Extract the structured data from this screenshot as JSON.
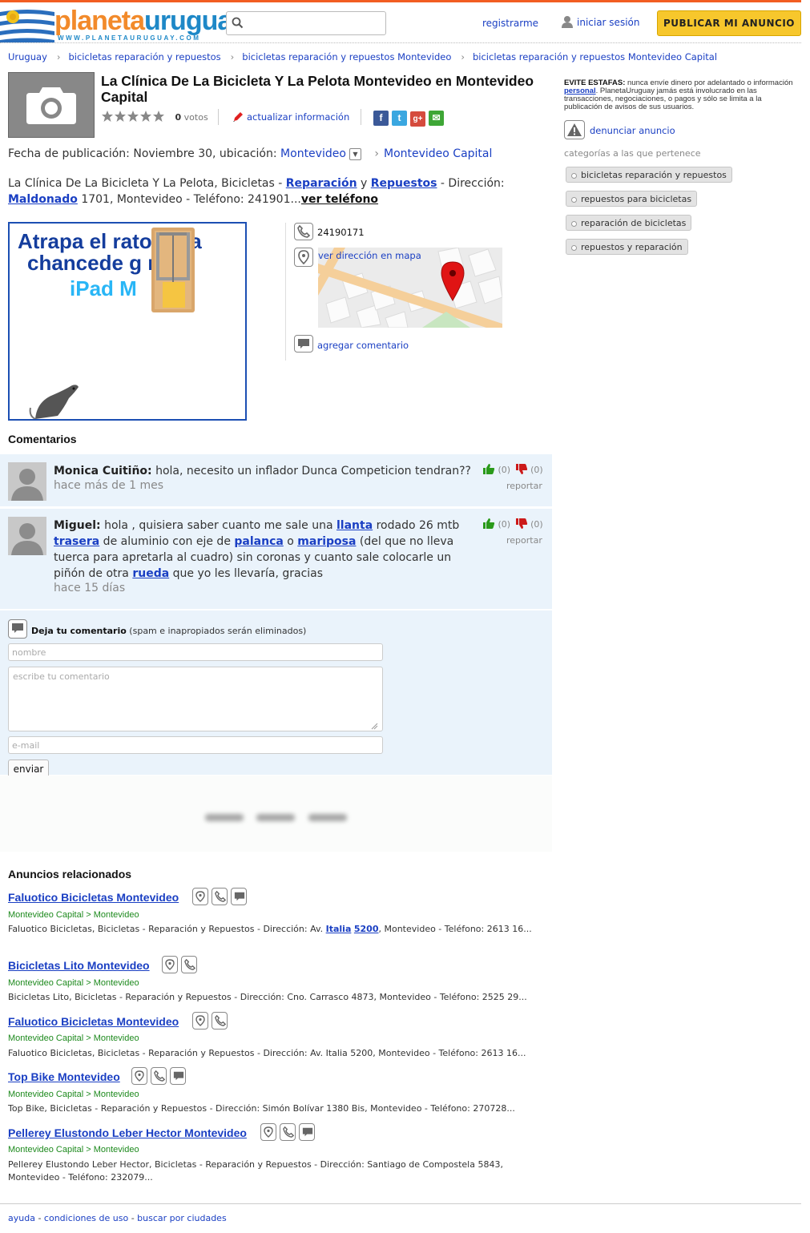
{
  "header": {
    "logo_part1": "planeta",
    "logo_part2": "uruguay",
    "logo_sub": "WWW.PLANETAURUGUAY.COM",
    "search_placeholder": "",
    "register": "registrarme",
    "login": "iniciar sesión",
    "publish": "PUBLICAR MI ANUNCIO"
  },
  "breadcrumb": [
    "Uruguay",
    "bicicletas reparación y repuestos",
    "bicicletas reparación y repuestos Montevideo",
    "bicicletas reparación y repuestos Montevideo Capital"
  ],
  "listing": {
    "title": "La Clínica De La Bicicleta Y La Pelota Montevideo en Montevideo Capital",
    "votes_count": "0",
    "votes_label": "votos",
    "update_link": "actualizar información",
    "pub_prefix": "Fecha de publicación: Noviembre 30, ubicación:",
    "location_city": "Montevideo",
    "location_area": "Montevideo Capital",
    "desc_1": "La Clínica De La Bicicleta Y La Pelota, Bicicletas - ",
    "desc_link1": "Reparación",
    "desc_2": " y ",
    "desc_link2": "Repuestos",
    "desc_3": " - Dirección: ",
    "desc_link3": "Maldonado",
    "desc_4": " 1701, Montevideo - Teléfono: 241901...",
    "desc_view_phone": "ver teléfono",
    "phone": "24190171",
    "map_link": "ver dirección en mapa",
    "add_comment": "agregar comentario"
  },
  "ad": {
    "line1": "Atrapa el rato   or la",
    "line2": "chancede g      r un",
    "line3": "iPad M"
  },
  "comments_title": "Comentarios",
  "comments": [
    {
      "author": "Monica Cuitiño:",
      "text": " hola, necesito un inflador Dunca Competicion tendran??",
      "time": "hace más de 1 mes",
      "likes": "(0)",
      "dislikes": "(0)",
      "report": "reportar"
    },
    {
      "author": "Miguel:",
      "t1": " hola , quisiera saber cuanto me sale una ",
      "l1": "llanta",
      "t2": " rodado 26 mtb ",
      "l2": "trasera",
      "t3": " de aluminio con eje de ",
      "l3": "palanca",
      "t4": " o ",
      "l4": "mariposa",
      "t5": " (del que no lleva tuerca para apretarla al cuadro) sin coronas y cuanto sale colocarle un piñón de otra ",
      "l5": "rueda",
      "t6": " que yo les llevaría, gracias",
      "time": "hace 15 días",
      "likes": "(0)",
      "dislikes": "(0)",
      "report": "reportar"
    }
  ],
  "form": {
    "title": "Deja tu comentario",
    "note": " (spam e inapropiados serán eliminados)",
    "name_placeholder": "nombre",
    "comment_placeholder": "escribe tu comentario",
    "email_placeholder": "e-mail",
    "send": "enviar"
  },
  "related_title": "Anuncios relacionados",
  "related": [
    {
      "title": "Faluotico Bicicletas Montevideo",
      "loc": "Montevideo Capital > Montevideo",
      "desc_a": "Faluotico Bicicletas, Bicicletas - Reparación y Repuestos - Dirección: Av. ",
      "link1": "Italia",
      "link2": "5200",
      "desc_b": ", Montevideo - Teléfono: 2613 16..."
    },
    {
      "title": "Bicicletas Lito Montevideo",
      "loc": "Montevideo Capital > Montevideo",
      "desc": "Bicicletas Lito, Bicicletas - Reparación y Repuestos - Dirección: Cno. Carrasco 4873, Montevideo - Teléfono: 2525 29..."
    },
    {
      "title": "Faluotico Bicicletas Montevideo",
      "loc": "Montevideo Capital > Montevideo",
      "desc": "Faluotico Bicicletas, Bicicletas - Reparación y Repuestos - Dirección: Av. Italia 5200, Montevideo - Teléfono: 2613 16..."
    },
    {
      "title": "Top Bike Montevideo",
      "loc": "Montevideo Capital > Montevideo",
      "desc": "Top Bike, Bicicletas - Reparación y Repuestos - Dirección: Simón Bolívar 1380 Bis, Montevideo - Teléfono: 270728..."
    },
    {
      "title": "Pellerey Elustondo Leber Hector Montevideo",
      "loc": "Montevideo Capital > Montevideo",
      "desc": "Pellerey Elustondo Leber Hector, Bicicletas - Reparación y Repuestos - Dirección: Santiago de Compostela 5843, Montevideo - Teléfono: 232079..."
    }
  ],
  "footer": {
    "help": "ayuda",
    "terms": "condiciones de uso",
    "cities": "buscar por ciudades",
    "sep": " - "
  },
  "sidebar": {
    "warn_title": "EVITE ESTAFAS:",
    "warn_1": " nunca envíe dinero por adelantado o información ",
    "warn_link": "personal",
    "warn_2": ". PlanetaUruguay jamás está involucrado en las transacciones, negociaciones, o pagos y sólo se limita a la publicación de avisos de sus usuarios.",
    "report": "denunciar anuncio",
    "cats_title": "categorías a las que pertenece",
    "tags": [
      "bicicletas reparación y repuestos",
      "repuestos para bicicletas",
      "reparación de bicicletas",
      "repuestos y reparación"
    ]
  },
  "colors": {
    "accent_orange": "#f25d22",
    "link_blue": "#1a3fc3",
    "publish_yellow": "#f7c72c",
    "comment_bg": "#eaf3fb",
    "location_green": "#1e8a1e"
  }
}
